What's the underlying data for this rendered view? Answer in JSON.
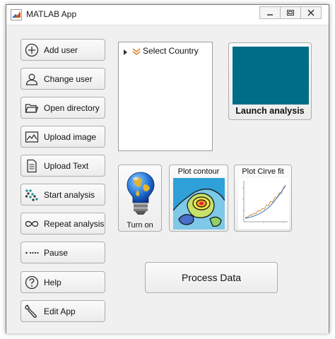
{
  "window": {
    "title": "MATLAB App",
    "controls": [
      "minimize-icon",
      "restore-icon",
      "close-icon"
    ]
  },
  "sidebar": {
    "buttons": [
      {
        "label": "Add user",
        "icon": "add-circle-icon"
      },
      {
        "label": "Change user",
        "icon": "user-icon"
      },
      {
        "label": "Open directory",
        "icon": "folder-icon"
      },
      {
        "label": "Upload image",
        "icon": "image-icon"
      },
      {
        "label": "Upload Text",
        "icon": "document-icon"
      },
      {
        "label": "Start analysis",
        "icon": "dots-pattern-icon"
      },
      {
        "label": "Repeat analysis",
        "icon": "loop-icon"
      },
      {
        "label": "Pause",
        "icon": "pause-dots-icon"
      },
      {
        "label": "Help",
        "icon": "help-icon"
      },
      {
        "label": "Edit App",
        "icon": "wrench-icon"
      }
    ]
  },
  "tree": {
    "node_label": "Select Country"
  },
  "launch": {
    "label": "Launch analysis",
    "swatch_color": "#006d86"
  },
  "tools": {
    "turn_on_label": "Turn on",
    "contour_label": "Plot contour",
    "curve_label": "Plot Cirve fit"
  },
  "process": {
    "label": "Process Data"
  }
}
